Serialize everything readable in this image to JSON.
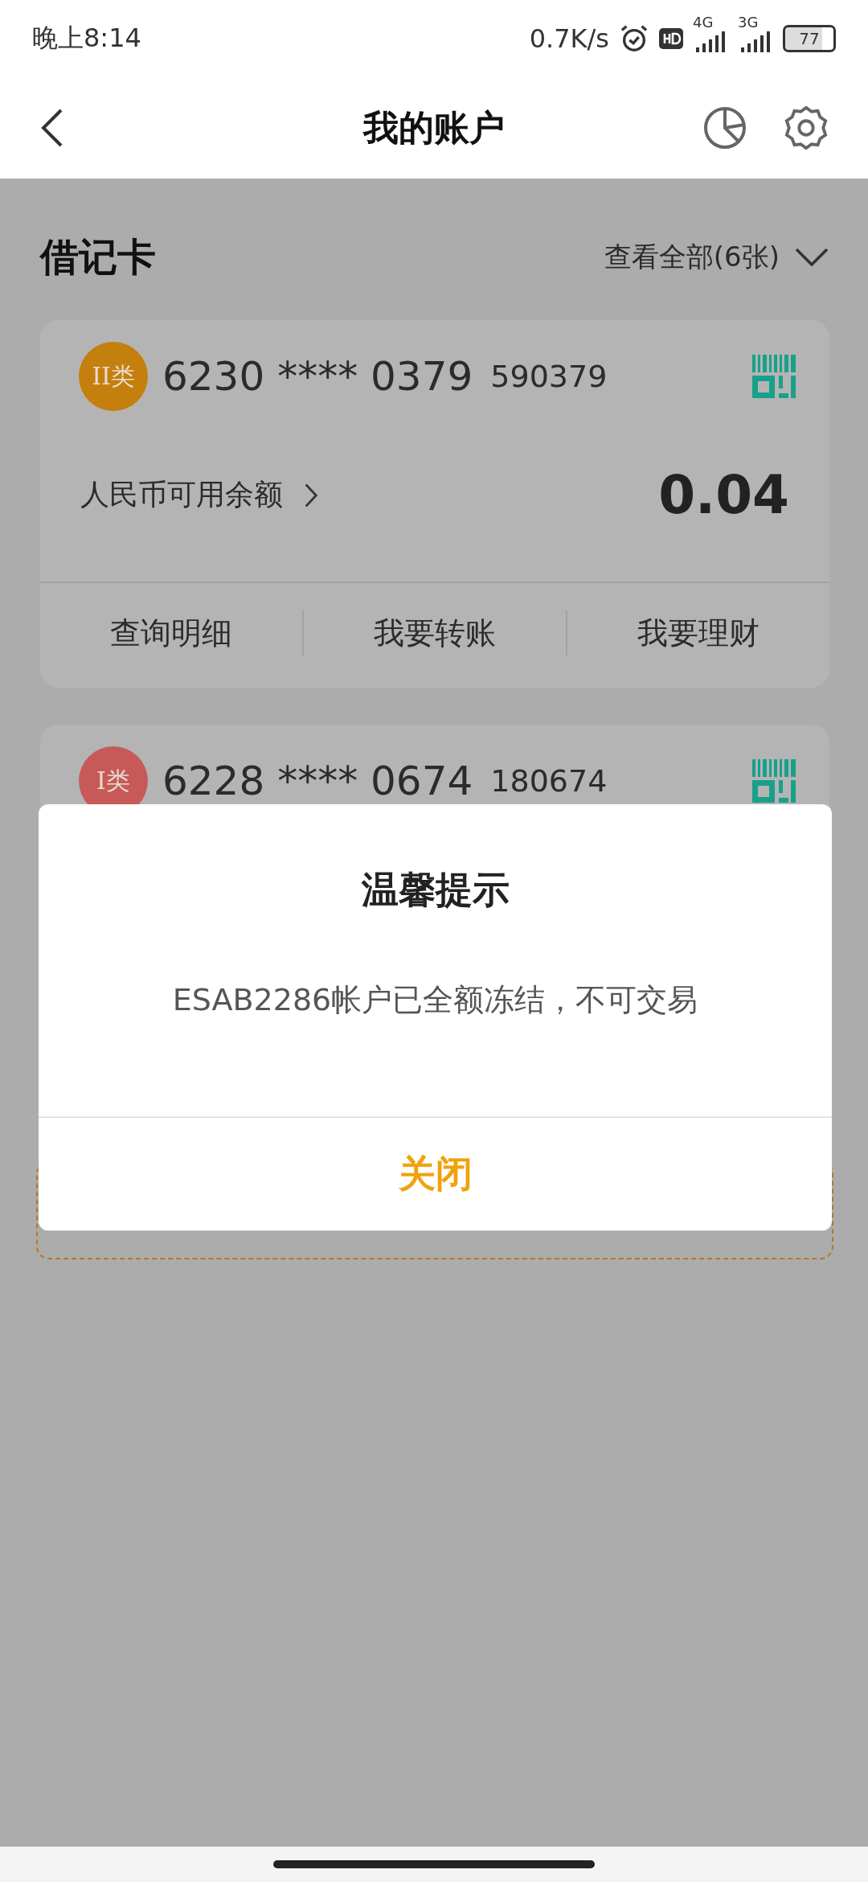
{
  "status_bar": {
    "time": "晚上8:14",
    "net_speed": "0.7K/s",
    "network_1": "4G",
    "network_2": "3G",
    "battery": "77"
  },
  "header": {
    "title": "我的账户"
  },
  "section": {
    "title": "借记卡",
    "view_all": "查看全部(6张)"
  },
  "cards": [
    {
      "badge": "II类",
      "color": "#c47f0c",
      "number": "6230 **** 0379",
      "code": "590379",
      "balance_label": "人民币可用余额",
      "balance": "0.04",
      "actions": [
        "查询明细",
        "我要转账",
        "我要理财"
      ]
    },
    {
      "badge": "I类",
      "color": "#c75a58",
      "number": "6228 **** 0674",
      "code": "180674"
    }
  ],
  "dialog": {
    "title": "温馨提示",
    "message": "ESAB2286帐户已全额冻结，不可交易",
    "button": "关闭"
  }
}
